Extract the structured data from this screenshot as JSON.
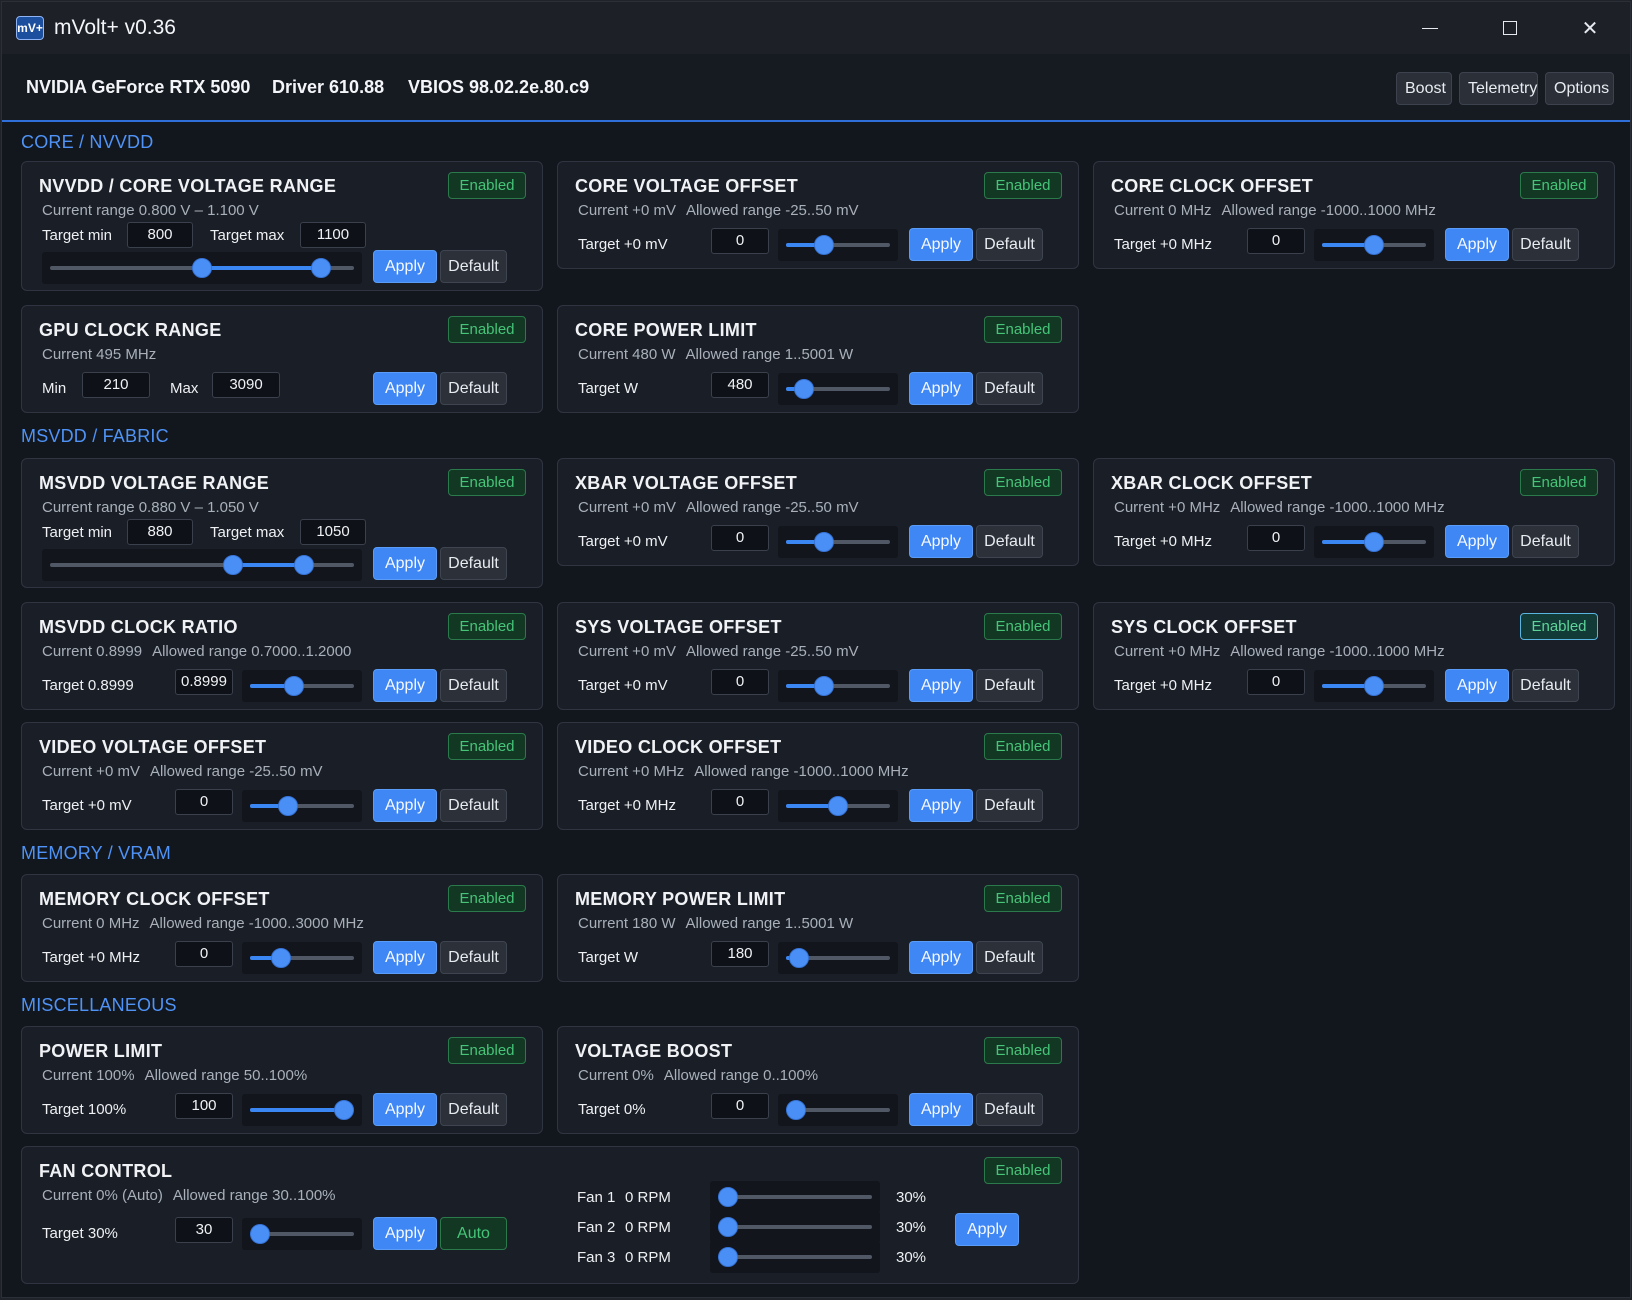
{
  "window": {
    "logo": "mV+",
    "title": "mVolt+ v0.36",
    "close_glyph": "✕"
  },
  "header": {
    "gpu": "NVIDIA GeForce RTX 5090",
    "driver": "Driver 610.88",
    "vbios": "VBIOS 98.02.2e.80.c9",
    "buttons": [
      "Boost",
      "Telemetry",
      "Options"
    ]
  },
  "common": {
    "enabled": "Enabled",
    "apply": "Apply",
    "default": "Default",
    "auto": "Auto"
  },
  "sections": {
    "core": "CORE / NVVDD",
    "msvdd": "MSVDD / FABRIC",
    "memory": "MEMORY / VRAM",
    "misc": "MISCELLANEOUS"
  },
  "cards": {
    "nvvdd_range": {
      "title": "NVVDD / CORE VOLTAGE RANGE",
      "current": "Current range 0.800 V – 1.100 V",
      "min_label": "Target min",
      "min_value": "800",
      "max_label": "Target max",
      "max_value": "1100",
      "slider_low": 0.5,
      "slider_high": 0.92
    },
    "core_voltage_offset": {
      "title": "CORE VOLTAGE OFFSET",
      "current": "Current +0 mV",
      "allowed": "Allowed range -25..50 mV",
      "target": "Target +0 mV",
      "value": "0",
      "slider": 0.33
    },
    "core_clock_offset": {
      "title": "CORE CLOCK OFFSET",
      "current": "Current 0 MHz",
      "allowed": "Allowed range -1000..1000 MHz",
      "target": "Target +0 MHz",
      "value": "0",
      "slider": 0.5
    },
    "gpu_clock_range": {
      "title": "GPU CLOCK RANGE",
      "current": "Current 495 MHz",
      "min_label": "Min",
      "min_value": "210",
      "max_label": "Max",
      "max_value": "3090"
    },
    "core_power_limit": {
      "title": "CORE POWER LIMIT",
      "current": "Current 480 W",
      "allowed": "Allowed range 1..5001 W",
      "target": "Target W",
      "value": "480",
      "slider": 0.1
    },
    "msvdd_range": {
      "title": "MSVDD VOLTAGE RANGE",
      "current": "Current range 0.880 V – 1.050 V",
      "min_label": "Target min",
      "min_value": "880",
      "max_label": "Target max",
      "max_value": "1050",
      "slider_low": 0.61,
      "slider_high": 0.86
    },
    "xbar_voltage_offset": {
      "title": "XBAR VOLTAGE OFFSET",
      "current": "Current +0 mV",
      "allowed": "Allowed range -25..50 mV",
      "target": "Target +0 mV",
      "value": "0",
      "slider": 0.33
    },
    "xbar_clock_offset": {
      "title": "XBAR CLOCK OFFSET",
      "current": "Current +0 MHz",
      "allowed": "Allowed range -1000..1000 MHz",
      "target": "Target +0 MHz",
      "value": "0",
      "slider": 0.5
    },
    "msvdd_clock_ratio": {
      "title": "MSVDD CLOCK RATIO",
      "current": "Current 0.8999",
      "allowed": "Allowed range 0.7000..1.2000",
      "target": "Target 0.8999",
      "value": "0.8999",
      "slider": 0.4
    },
    "sys_voltage_offset": {
      "title": "SYS VOLTAGE OFFSET",
      "current": "Current +0 mV",
      "allowed": "Allowed range -25..50 mV",
      "target": "Target +0 mV",
      "value": "0",
      "slider": 0.33
    },
    "sys_clock_offset": {
      "title": "SYS CLOCK OFFSET",
      "current": "Current +0 MHz",
      "allowed": "Allowed range -1000..1000 MHz",
      "target": "Target +0 MHz",
      "value": "0",
      "slider": 0.5
    },
    "video_voltage_offset": {
      "title": "VIDEO VOLTAGE OFFSET",
      "current": "Current +0 mV",
      "allowed": "Allowed range -25..50 mV",
      "target": "Target +0 mV",
      "value": "0",
      "slider": 0.33
    },
    "video_clock_offset": {
      "title": "VIDEO CLOCK OFFSET",
      "current": "Current +0 MHz",
      "allowed": "Allowed range -1000..1000 MHz",
      "target": "Target +0 MHz",
      "value": "0",
      "slider": 0.5
    },
    "memory_clock_offset": {
      "title": "MEMORY CLOCK OFFSET",
      "current": "Current 0 MHz",
      "allowed": "Allowed range -1000..3000 MHz",
      "target": "Target +0 MHz",
      "value": "0",
      "slider": 0.25
    },
    "memory_power_limit": {
      "title": "MEMORY POWER LIMIT",
      "current": "Current 180 W",
      "allowed": "Allowed range 1..5001 W",
      "target": "Target W",
      "value": "180",
      "slider": 0.04
    },
    "power_limit": {
      "title": "POWER LIMIT",
      "current": "Current 100%",
      "allowed": "Allowed range 50..100%",
      "target": "Target 100%",
      "value": "100",
      "slider": 1.0
    },
    "voltage_boost": {
      "title": "VOLTAGE BOOST",
      "current": "Current 0%",
      "allowed": "Allowed range 0..100%",
      "target": "Target 0%",
      "value": "0",
      "slider": 0.0
    },
    "fan_control": {
      "title": "FAN CONTROL",
      "current": "Current 0% (Auto)",
      "allowed": "Allowed range 30..100%",
      "target": "Target 30%",
      "value": "30",
      "slider": 0.0,
      "fans": [
        {
          "name": "Fan 1",
          "rpm": "0 RPM",
          "pct": "30%",
          "slider": 0.0
        },
        {
          "name": "Fan 2",
          "rpm": "0 RPM",
          "pct": "30%",
          "slider": 0.0
        },
        {
          "name": "Fan 3",
          "rpm": "0 RPM",
          "pct": "30%",
          "slider": 0.0
        }
      ]
    }
  }
}
